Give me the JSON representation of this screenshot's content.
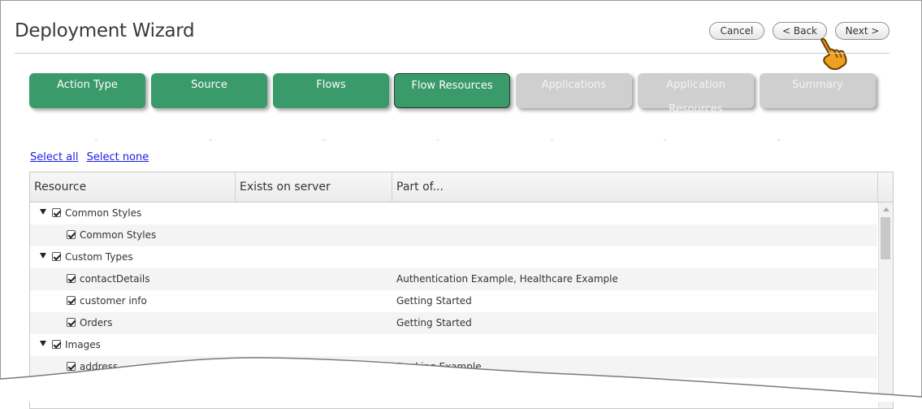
{
  "title": "Deployment Wizard",
  "header_buttons": {
    "cancel": "Cancel",
    "back": "< Back",
    "next": "Next >"
  },
  "steps": [
    {
      "label": "Action Type",
      "state": "done"
    },
    {
      "label": "Source",
      "state": "done"
    },
    {
      "label": "Flows",
      "state": "done"
    },
    {
      "label": "Flow Resources",
      "state": "active"
    },
    {
      "label": "Applications",
      "state": "todo"
    },
    {
      "label": "Application Resources",
      "state": "todo"
    },
    {
      "label": "Summary",
      "state": "todo"
    }
  ],
  "selection_links": {
    "select_all": "Select all",
    "select_none": "Select none"
  },
  "table": {
    "columns": [
      "Resource",
      "Exists on server",
      "Part of..."
    ],
    "rows": [
      {
        "resource": "Common Styles",
        "level": 0,
        "group": true,
        "checked": true,
        "part_of": ""
      },
      {
        "resource": "Common Styles",
        "level": 1,
        "group": false,
        "checked": true,
        "part_of": ""
      },
      {
        "resource": "Custom Types",
        "level": 0,
        "group": true,
        "checked": true,
        "part_of": ""
      },
      {
        "resource": "contactDetails",
        "level": 1,
        "group": false,
        "checked": true,
        "part_of": "Authentication Example, Healthcare Example"
      },
      {
        "resource": "customer info",
        "level": 1,
        "group": false,
        "checked": true,
        "part_of": "Getting Started"
      },
      {
        "resource": "Orders",
        "level": 1,
        "group": false,
        "checked": true,
        "part_of": "Getting Started"
      },
      {
        "resource": "Images",
        "level": 0,
        "group": true,
        "checked": true,
        "part_of": ""
      },
      {
        "resource": "address",
        "level": 1,
        "group": false,
        "checked": true,
        "part_of": "Banking Example"
      }
    ]
  },
  "colors": {
    "step_done": "#3a9a6a",
    "step_todo": "#cfcfcf",
    "link": "#1a1aee"
  },
  "icons": [
    "pointing-hand-icon",
    "expand-triangle-icon",
    "checkbox-checked-icon",
    "scroll-up-arrow-icon"
  ]
}
